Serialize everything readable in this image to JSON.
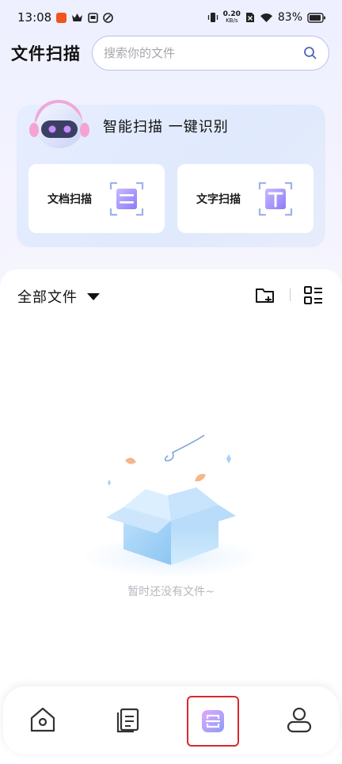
{
  "status_bar": {
    "time": "13:08",
    "net_speed_value": "0.20",
    "net_speed_unit": "KB/s",
    "battery": "83%"
  },
  "header": {
    "title": "文件扫描",
    "search_placeholder": "搜索你的文件"
  },
  "scan_card": {
    "title": "智能扫描  一键识别",
    "doc_scan_label": "文档扫描",
    "text_scan_label": "文字扫描"
  },
  "files": {
    "filter_label": "全部文件",
    "empty_text": "暂时还没有文件~"
  },
  "bottom_nav": {
    "active": "scan",
    "items": [
      "home-icon",
      "documents-icon",
      "scan-icon",
      "profile-icon"
    ]
  },
  "colors": {
    "accent": "#8b7cf6",
    "highlight_border": "#d9282f"
  }
}
